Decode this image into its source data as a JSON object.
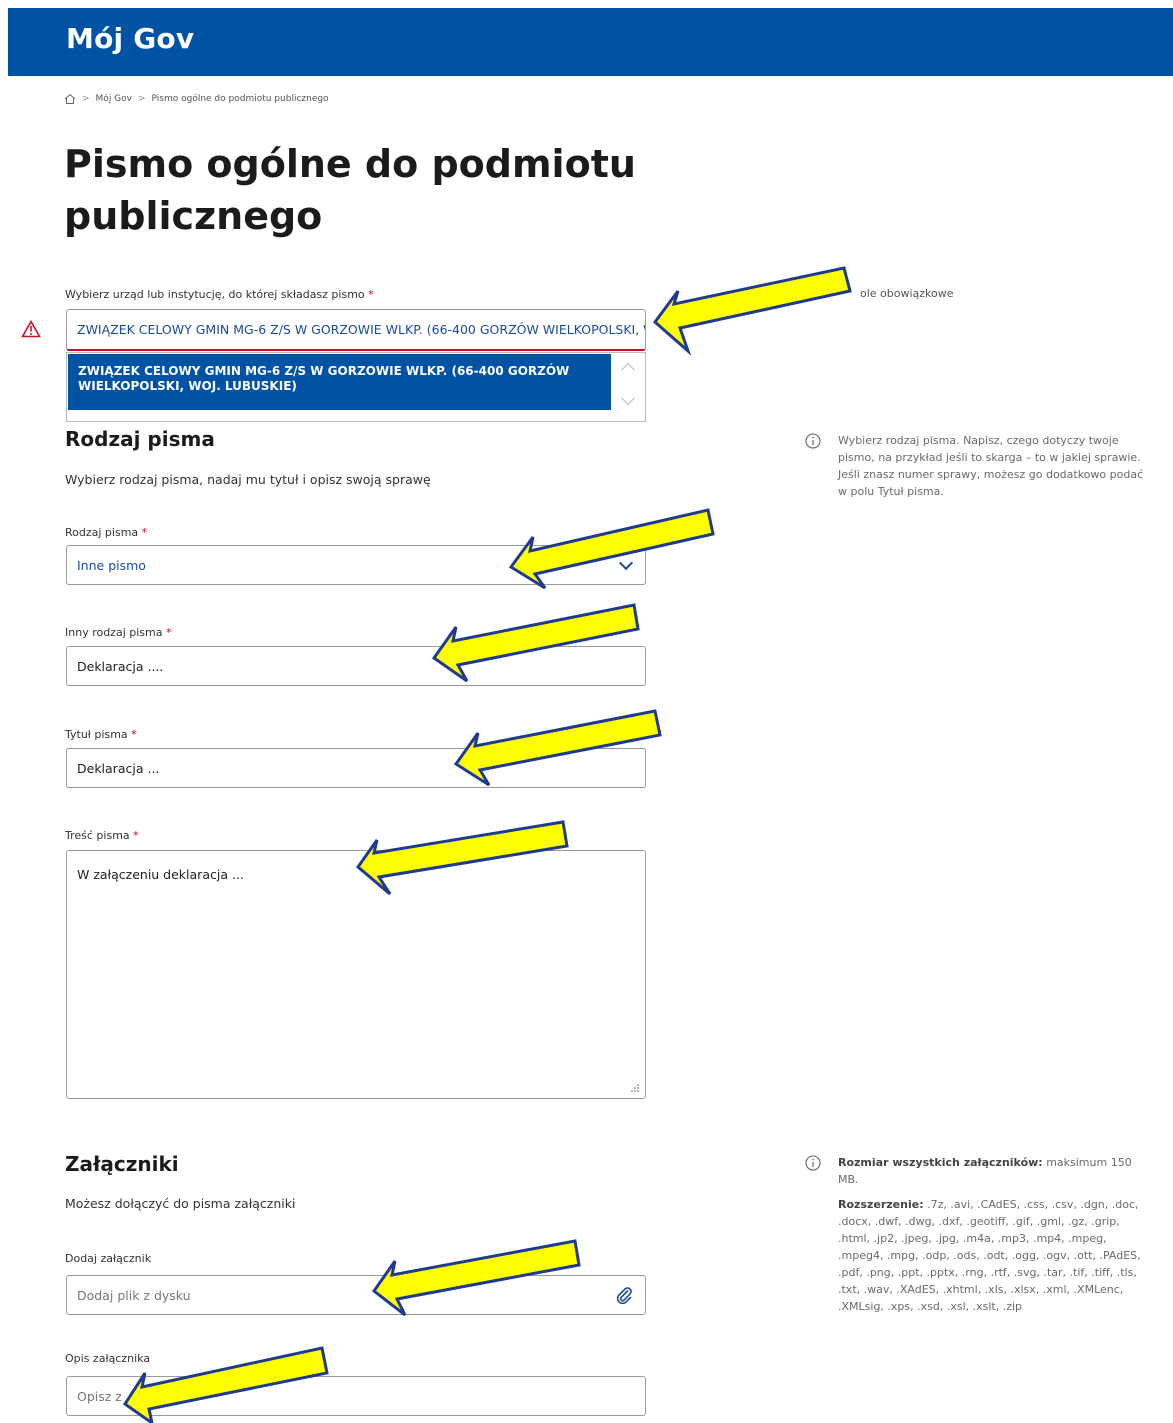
{
  "header": {
    "brand": "Mój Gov"
  },
  "breadcrumb": {
    "home_icon": "home-icon",
    "items": [
      "Mój Gov",
      "Pismo ogólne do podmiotu publicznego"
    ],
    "separator": ">"
  },
  "page": {
    "title": "Pismo ogólne do podmiotu publicznego"
  },
  "required_note": "ole obowiązkowe",
  "institution": {
    "label": "Wybierz urząd lub instytucję, do której składasz pismo",
    "value": "ZWIĄZEK CELOWY GMIN MG-6 Z/S W GORZOWIE WLKP. (66-400 GORZÓW WIELKOPOLSKI, WOJ. LUBUSKIE)",
    "dropdown_option": "ZWIĄZEK CELOWY GMIN MG-6 Z/S W GORZOWIE WLKP. (66-400 GORZÓW WIELKOPOLSKI, WOJ. LUBUSKIE)"
  },
  "letter_section": {
    "title": "Rodzaj pisma",
    "description": "Wybierz rodzaj pisma, nadaj mu tytuł i opisz swoją sprawę",
    "info": "Wybierz rodzaj pisma. Napisz, czego dotyczy twoje pismo, na przykład jeśli to skarga – to w jakiej sprawie. Jeśli znasz numer sprawy, możesz go dodatkowo podać w polu Tytuł pisma."
  },
  "fields": {
    "letter_type": {
      "label": "Rodzaj pisma",
      "value": "Inne pismo"
    },
    "other_type": {
      "label": "Inny rodzaj pisma",
      "value": "Deklaracja ...."
    },
    "title": {
      "label": "Tytuł pisma",
      "value": "Deklaracja ..."
    },
    "content": {
      "label": "Treść pisma",
      "value": "W załączeniu deklaracja ..."
    }
  },
  "attachments": {
    "title": "Załączniki",
    "description": "Możesz dołączyć do pisma załączniki",
    "add_label": "Dodaj załącznik",
    "add_placeholder": "Dodaj plik z dysku",
    "desc_label": "Opis załącznika",
    "desc_placeholder": "Opisz z",
    "info_size_bold": "Rozmiar wszystkich załączników:",
    "info_size": "maksimum 150 MB.",
    "info_ext_bold": "Rozszerzenie:",
    "info_ext": ".7z, .avi, .CAdES, .css, .csv, .dgn, .doc, .docx, .dwf, .dwg, .dxf, .geotiff, .gif, .gml, .gz, .grip, .html, .jp2, .jpeg, .jpg, .m4a, .mp3, .mp4, .mpeg, .mpeg4, .mpg, .odp, .ods, .odt, .ogg, .ogv, .ott, .PAdES, .pdf, .png, .ppt, .pptx, .rng, .rtf, .svg, .tar, .tif, .tiff, .tls, .txt, .wav, .XAdES, .xhtml, .xls, .xlsx, .xml, .XMLenc, .XMLsig, .xps, .xsd, .xsl, .xslt, .zip"
  },
  "required_mark": "*",
  "colors": {
    "brand": "#0052a5",
    "error": "#c8102e",
    "arrow_fill": "#ffff00",
    "arrow_stroke": "#1f3b8f"
  }
}
